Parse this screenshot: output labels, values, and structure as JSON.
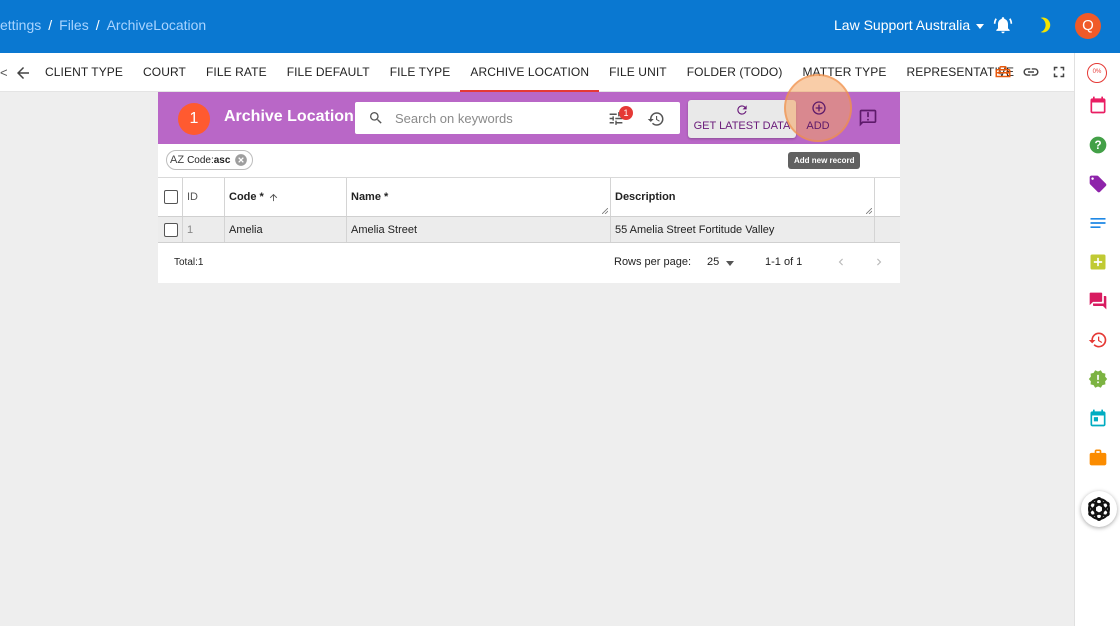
{
  "header": {
    "breadcrumb": [
      "ettings",
      "Files",
      "ArchiveLocation"
    ],
    "organization": "Law Support Australia",
    "avatar_initial": "Q"
  },
  "tabs": {
    "prev_fragment": "<",
    "items": [
      {
        "label": "CLIENT TYPE",
        "active": false
      },
      {
        "label": "COURT",
        "active": false
      },
      {
        "label": "FILE RATE",
        "active": false
      },
      {
        "label": "FILE DEFAULT",
        "active": false
      },
      {
        "label": "FILE TYPE",
        "active": false
      },
      {
        "label": "ARCHIVE LOCATION",
        "active": true
      },
      {
        "label": "FILE UNIT",
        "active": false
      },
      {
        "label": "FOLDER (TODO)",
        "active": false
      },
      {
        "label": "MATTER TYPE",
        "active": false
      },
      {
        "label": "REPRESENTATIVE",
        "active": false
      }
    ]
  },
  "sidebar": {
    "progress_label": "0%",
    "icons": [
      "calendar-icon",
      "help-icon",
      "tag-icon",
      "notes-icon",
      "note-add-icon",
      "chat-icon",
      "history-icon",
      "alert-badge-icon",
      "event-icon",
      "briefcase-icon",
      "ai-assistant-icon"
    ]
  },
  "panel": {
    "record_count": "1",
    "title": "Archive Location",
    "search_placeholder": "Search on keywords",
    "filter_count": "1",
    "get_latest_label": "GET LATEST DATA",
    "add_label": "ADD",
    "add_tooltip": "Add new record",
    "sort_chip": {
      "prefix": "AZ",
      "field": "Code:",
      "direction": "asc"
    }
  },
  "table": {
    "columns": [
      "ID",
      "Code *",
      "Name *",
      "Description"
    ],
    "rows": [
      {
        "id": "1",
        "code": "Amelia",
        "name": "Amelia Street",
        "description": "55 Amelia Street Fortitude Valley"
      }
    ]
  },
  "pagination": {
    "total": "Total:1",
    "rows_per_page_label": "Rows per page:",
    "rows_per_page": "25",
    "range": "1-1 of 1"
  },
  "colors": {
    "header_blue": "#0a78d1",
    "panel_purple": "#b967c7",
    "accent_orange": "#ff5a30",
    "active_tab_underline": "#e53935"
  }
}
